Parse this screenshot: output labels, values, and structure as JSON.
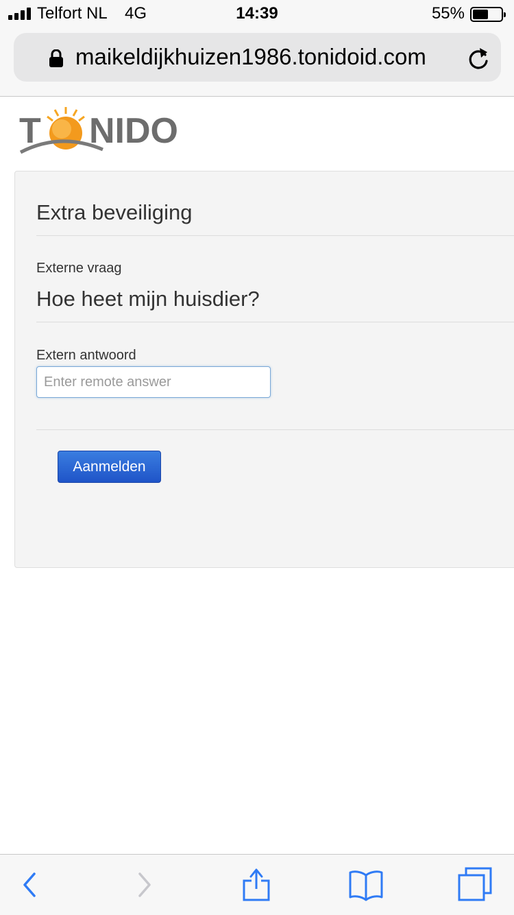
{
  "status_bar": {
    "carrier": "Telfort NL",
    "network": "4G",
    "time": "14:39",
    "battery_percent": "55%",
    "battery_level": 0.55,
    "signal_bars": 4
  },
  "browser": {
    "url": "maikeldijkhuizen1986.tonidoid.com",
    "icons": [
      "lock-icon",
      "reload-icon"
    ]
  },
  "logo": {
    "text": "TONIDO"
  },
  "security_panel": {
    "title": "Extra beveiliging",
    "question_label": "Externe vraag",
    "question": "Hoe heet mijn huisdier?",
    "answer_label": "Extern antwoord",
    "answer_placeholder": "Enter remote answer",
    "answer_value": "",
    "submit_label": "Aanmelden"
  },
  "toolbar": {
    "icons": [
      "back-icon",
      "forward-icon",
      "share-icon",
      "bookmarks-icon",
      "tabs-icon"
    ],
    "accent_color": "#2f7bf5",
    "disabled_color": "#c7c7cc"
  },
  "colors": {
    "button": "#2a66d6",
    "panel_background": "#f4f4f4",
    "logo_text": "#6d6d6d",
    "logo_sun": "#f39a1d"
  }
}
